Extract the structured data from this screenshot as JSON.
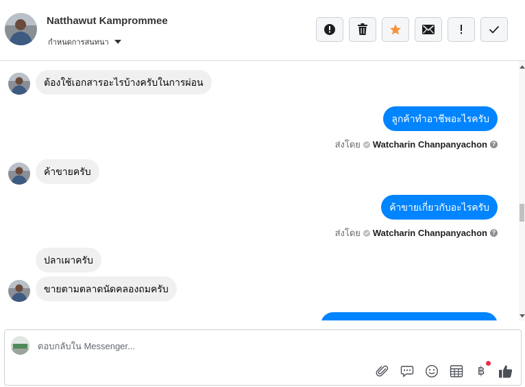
{
  "header": {
    "name": "Natthawut Kamprommee",
    "subtitle": "กำหนดการสนทนา",
    "actions": [
      {
        "icon": "alert-circle-icon",
        "name": "report-button"
      },
      {
        "icon": "trash-icon",
        "name": "delete-button"
      },
      {
        "icon": "star-icon",
        "name": "star-button"
      },
      {
        "icon": "envelope-icon",
        "name": "mark-unread-button"
      },
      {
        "icon": "exclamation-icon",
        "name": "follow-up-button"
      },
      {
        "icon": "check-icon",
        "name": "mark-done-button"
      }
    ]
  },
  "messages": [
    {
      "direction": "in",
      "text": "ต้องใช้เอกสารอะไรบ้างครับในการผ่อน"
    },
    {
      "direction": "out",
      "text": "ลูกค้าทำอาชีพอะไรครับ",
      "sent_by_label": "ส่งโดย",
      "sender": "Watcharin Chanpanyachon"
    },
    {
      "direction": "in",
      "text": "ค้าขายครับ"
    },
    {
      "direction": "out",
      "text": "ค้าขายเกี่ยวกับอะไรครับ",
      "sent_by_label": "ส่งโดย",
      "sender": "Watcharin Chanpanyachon"
    },
    {
      "direction": "in",
      "text": "ปลาเผาครับ"
    },
    {
      "direction": "in",
      "text": "ขายตามตลาดนัดคลองถมครับ"
    }
  ],
  "composer": {
    "placeholder": "ตอบกลับใน Messenger...",
    "tools": [
      "paperclip-icon",
      "chat-bubble-icon",
      "smiley-icon",
      "table-icon",
      "baht-icon",
      "thumbs-up-icon"
    ],
    "baht_symbol": "฿"
  },
  "colors": {
    "outgoing_bubble": "#0084ff",
    "incoming_bubble": "#f0f0f0",
    "star": "#f7923b",
    "notification_dot": "#f02849"
  }
}
